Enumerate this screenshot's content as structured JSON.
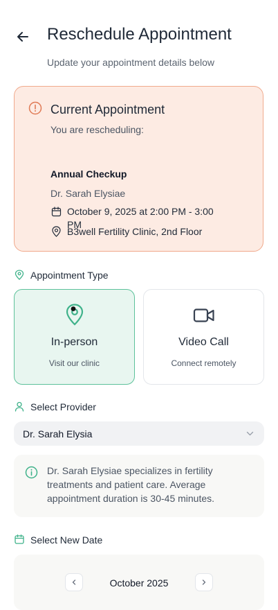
{
  "header": {
    "title": "Reschedule Appointment",
    "subtitle": "Update your appointment details below"
  },
  "current_appointment": {
    "title": "Current Appointment",
    "subtitle": "You are rescheduling:",
    "name": "Annual Checkup",
    "doctor": "Dr. Sarah Elysiae",
    "datetime": "October 9, 2025 at 2:00 PM - 3:00 PM",
    "location": "B3well Fertility Clinic, 2nd Floor"
  },
  "appointment_type": {
    "label": "Appointment Type",
    "options": [
      {
        "title": "In-person",
        "subtitle": "Visit our clinic",
        "selected": true
      },
      {
        "title": "Video Call",
        "subtitle": "Connect remotely",
        "selected": false
      }
    ]
  },
  "provider": {
    "label": "Select Provider",
    "selected": "Dr. Sarah Elysia",
    "info": "Dr. Sarah Elysiae specializes in fertility treatments and patient care. Average appointment duration is 30-45 minutes."
  },
  "date": {
    "label": "Select New Date",
    "month": "October 2025"
  },
  "colors": {
    "accent": "#3fb28a",
    "warning": "#e07a55",
    "warning_bg": "#fdebe3"
  }
}
